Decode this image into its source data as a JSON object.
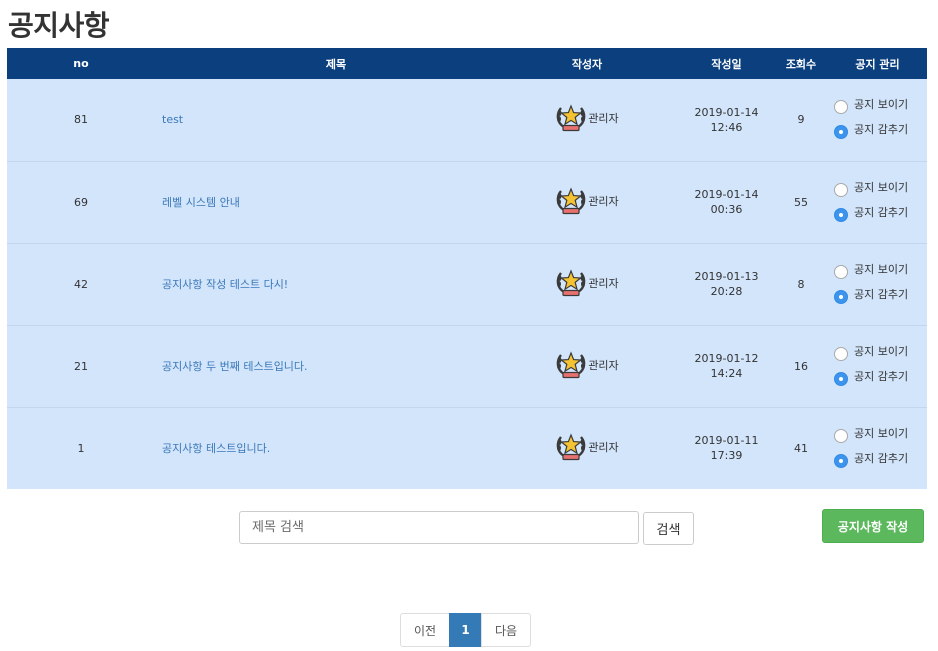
{
  "page": {
    "title": "공지사항"
  },
  "table": {
    "headers": {
      "no": "no",
      "title": "제목",
      "author": "작성자",
      "date": "작성일",
      "views": "조회수",
      "manage": "공지 관리"
    },
    "rows": [
      {
        "no": "81",
        "title": "test",
        "author": "관리자",
        "date": "2019-01-14",
        "time": "12:46",
        "views": "9",
        "show_label": "공지 보이기",
        "hide_label": "공지 감추기",
        "selected": "hide"
      },
      {
        "no": "69",
        "title": "레벨 시스템 안내",
        "author": "관리자",
        "date": "2019-01-14",
        "time": "00:36",
        "views": "55",
        "show_label": "공지 보이기",
        "hide_label": "공지 감추기",
        "selected": "hide"
      },
      {
        "no": "42",
        "title": "공지사항 작성 테스트 다시!",
        "author": "관리자",
        "date": "2019-01-13",
        "time": "20:28",
        "views": "8",
        "show_label": "공지 보이기",
        "hide_label": "공지 감추기",
        "selected": "hide"
      },
      {
        "no": "21",
        "title": "공지사항 두 번째 테스트입니다.",
        "author": "관리자",
        "date": "2019-01-12",
        "time": "14:24",
        "views": "16",
        "show_label": "공지 보이기",
        "hide_label": "공지 감추기",
        "selected": "hide"
      },
      {
        "no": "1",
        "title": "공지사항 테스트입니다.",
        "author": "관리자",
        "date": "2019-01-11",
        "time": "17:39",
        "views": "41",
        "show_label": "공지 보이기",
        "hide_label": "공지 감추기",
        "selected": "hide"
      }
    ]
  },
  "search": {
    "placeholder": "제목 검색",
    "button_label": "검색"
  },
  "write_button_label": "공지사항 작성",
  "pagination": {
    "prev": "이전",
    "current": "1",
    "next": "다음"
  },
  "icons": {
    "author_badge": "admin-laurel-star-icon"
  },
  "colors": {
    "header_bg": "#0b3f7e",
    "row_bg": "#d3e5fb",
    "link": "#3a78b8",
    "write_button": "#5cb85c",
    "pagination_active": "#337ab7",
    "radio_checked": "#3d94ec"
  }
}
